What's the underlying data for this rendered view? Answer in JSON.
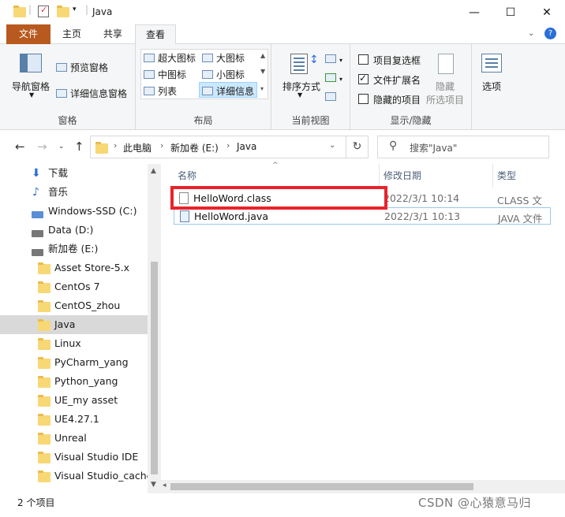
{
  "window": {
    "title": "Java",
    "controls": {
      "minimize": "—",
      "maximize": "☐",
      "close": "✕"
    }
  },
  "ribbon_tabs": [
    "文件",
    "主页",
    "共享",
    "查看"
  ],
  "ribbon": {
    "panes": {
      "label": "窗格",
      "nav_pane": "导航窗格",
      "preview_pane": "预览窗格",
      "details_pane": "详细信息窗格"
    },
    "layout": {
      "label": "布局",
      "items": [
        "超大图标",
        "大图标",
        "中图标",
        "小图标",
        "列表",
        "详细信息"
      ]
    },
    "current_view": {
      "label": "当前视图",
      "sort_by": "排序方式"
    },
    "show_hide": {
      "label": "显示/隐藏",
      "item_checkboxes": {
        "label": "项目复选框",
        "checked": false
      },
      "file_extensions": {
        "label": "文件扩展名",
        "checked": true
      },
      "hidden_items": {
        "label": "隐藏的项目",
        "checked": false
      },
      "hide_selected_1": "隐藏",
      "hide_selected_2": "所选项目"
    },
    "options": "选项"
  },
  "address": {
    "crumbs": [
      "此电脑",
      "新加卷 (E:)",
      "Java"
    ],
    "search_placeholder": "搜索\"Java\""
  },
  "sidebar": {
    "items": [
      {
        "label": "下载",
        "icon": "download-arrow-icon"
      },
      {
        "label": "音乐",
        "icon": "music-note-icon"
      },
      {
        "label": "Windows-SSD (C:)",
        "icon": "windows-drive-icon"
      },
      {
        "label": "Data (D:)",
        "icon": "drive-icon"
      },
      {
        "label": "新加卷 (E:)",
        "icon": "drive-icon"
      },
      {
        "label": "Asset Store-5.x",
        "icon": "folder-icon"
      },
      {
        "label": "CentOs 7",
        "icon": "folder-icon"
      },
      {
        "label": "CentOS_zhou",
        "icon": "folder-icon"
      },
      {
        "label": "Java",
        "icon": "folder-icon",
        "selected": true
      },
      {
        "label": "Linux",
        "icon": "folder-icon"
      },
      {
        "label": "PyCharm_yang",
        "icon": "folder-icon"
      },
      {
        "label": "Python_yang",
        "icon": "folder-icon"
      },
      {
        "label": "UE_my asset",
        "icon": "folder-icon"
      },
      {
        "label": "UE4.27.1",
        "icon": "folder-icon"
      },
      {
        "label": "Unreal",
        "icon": "folder-icon"
      },
      {
        "label": "Visual Studio IDE",
        "icon": "folder-icon"
      },
      {
        "label": "Visual Studio_cache",
        "icon": "folder-icon"
      }
    ]
  },
  "file_list": {
    "columns": {
      "name": "名称",
      "modified": "修改日期",
      "type": "类型"
    },
    "rows": [
      {
        "name": "HelloWord.class",
        "modified": "2022/3/1 10:14",
        "type": "CLASS 文件",
        "icon": "class-file-icon"
      },
      {
        "name": "HelloWord.java",
        "modified": "2022/3/1 10:13",
        "type": "JAVA 文件",
        "icon": "java-file-icon"
      }
    ]
  },
  "status": {
    "item_count": "2 个项目"
  },
  "watermark": "CSDN @心猿意马归"
}
